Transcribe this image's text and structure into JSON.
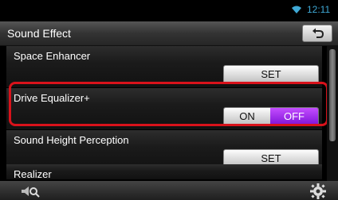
{
  "status": {
    "time": "12:11",
    "wifi_icon": "wifi-icon"
  },
  "header": {
    "title": "Sound Effect",
    "back_icon": "back-arrow-icon"
  },
  "rows": [
    {
      "label": "Space Enhancer",
      "button": "SET"
    },
    {
      "label": "Drive Equalizer+",
      "toggle_on": "ON",
      "toggle_off": "OFF",
      "selected": "OFF"
    },
    {
      "label": "Sound Height Perception",
      "button": "SET"
    },
    {
      "label": "Realizer"
    }
  ],
  "footer": {
    "left_icon": "speaker-search-icon",
    "right_icon": "gear-icon"
  },
  "colors": {
    "accent": "#3fa9d6",
    "toggle_selected": "#9b2be6",
    "highlight": "#d8121b"
  }
}
